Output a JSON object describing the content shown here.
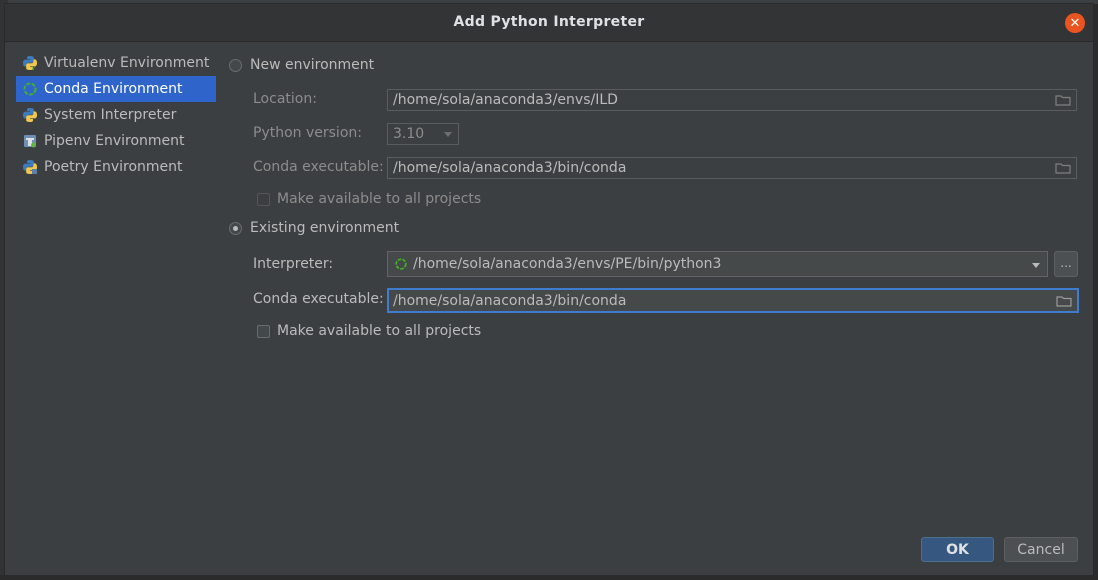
{
  "dialog": {
    "title": "Add Python Interpreter"
  },
  "sidebar": {
    "items": [
      {
        "label": "Virtualenv Environment",
        "icon": "python-venv-icon"
      },
      {
        "label": "Conda Environment",
        "icon": "conda-icon",
        "selected": true
      },
      {
        "label": "System Interpreter",
        "icon": "python-icon"
      },
      {
        "label": "Pipenv Environment",
        "icon": "pipenv-icon"
      },
      {
        "label": "Poetry Environment",
        "icon": "poetry-icon"
      }
    ]
  },
  "new_env": {
    "radio_label": "New environment",
    "location_label": "Location:",
    "location_value": "/home/sola/anaconda3/envs/ILD",
    "python_version_label": "Python version:",
    "python_version_value": "3.10",
    "conda_exec_label": "Conda executable:",
    "conda_exec_value": "/home/sola/anaconda3/bin/conda",
    "make_available_label": "Make available to all projects"
  },
  "existing_env": {
    "radio_label": "Existing environment",
    "interpreter_label": "Interpreter:",
    "interpreter_value": "/home/sola/anaconda3/envs/PE/bin/python3",
    "browse_label": "...",
    "conda_exec_label": "Conda executable:",
    "conda_exec_value": "/home/sola/anaconda3/bin/conda",
    "make_available_label": "Make available to all projects"
  },
  "buttons": {
    "ok": "OK",
    "cancel": "Cancel"
  },
  "colors": {
    "accent": "#2f65ca",
    "close": "#e95420",
    "ok_button": "#365880",
    "focus_border": "#3d7ccf"
  }
}
